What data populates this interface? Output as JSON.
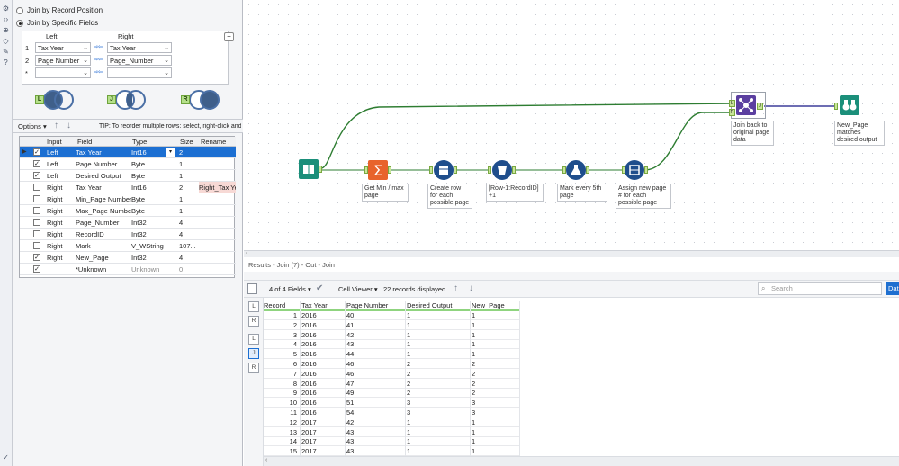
{
  "config": {
    "radio_record": "Join by Record Position",
    "radio_fields": "Join by Specific Fields",
    "hdr_left": "Left",
    "hdr_right": "Right",
    "join_rows": [
      {
        "num": "1",
        "left": "Tax Year",
        "right": "Tax Year"
      },
      {
        "num": "2",
        "left": "Page Number",
        "right": "Page_Number"
      },
      {
        "num": "*",
        "left": "",
        "right": ""
      }
    ],
    "venn_tags": [
      "L",
      "J",
      "R"
    ],
    "options_label": "Options",
    "tip": "TIP: To reorder multiple rows: select, right-click and dr",
    "select_headers": [
      "Input",
      "Field",
      "Type",
      "Size",
      "Rename"
    ],
    "select_rows": [
      {
        "checked": true,
        "input": "Left",
        "field": "Tax Year",
        "type": "Int16",
        "size": "2",
        "rename": ""
      },
      {
        "checked": true,
        "input": "Left",
        "field": "Page Number",
        "type": "Byte",
        "size": "1",
        "rename": ""
      },
      {
        "checked": true,
        "input": "Left",
        "field": "Desired Output",
        "type": "Byte",
        "size": "1",
        "rename": ""
      },
      {
        "checked": false,
        "input": "Right",
        "field": "Tax Year",
        "type": "Int16",
        "size": "2",
        "rename": "Right_Tax Yea"
      },
      {
        "checked": false,
        "input": "Right",
        "field": "Min_Page Number",
        "type": "Byte",
        "size": "1",
        "rename": ""
      },
      {
        "checked": false,
        "input": "Right",
        "field": "Max_Page Number",
        "type": "Byte",
        "size": "1",
        "rename": ""
      },
      {
        "checked": false,
        "input": "Right",
        "field": "Page_Number",
        "type": "Int32",
        "size": "4",
        "rename": ""
      },
      {
        "checked": false,
        "input": "Right",
        "field": "RecordID",
        "type": "Int32",
        "size": "4",
        "rename": ""
      },
      {
        "checked": false,
        "input": "Right",
        "field": "Mark",
        "type": "V_WString",
        "size": "107...",
        "rename": ""
      },
      {
        "checked": true,
        "input": "Right",
        "field": "New_Page",
        "type": "Int32",
        "size": "4",
        "rename": ""
      },
      {
        "checked": true,
        "input": "",
        "field": "*Unknown",
        "type": "Unknown",
        "size": "0",
        "rename": ""
      }
    ]
  },
  "canvas": {
    "labels": {
      "summarize": "Get Min / max page",
      "generate": "Create row for each possible page",
      "formula": "[Row-1:RecordID] +1",
      "filter": "Mark every 5th page",
      "multirow": "Assign new page # for each possible page",
      "join": "Join back to original page data",
      "browse": "New_Page matches desired output"
    },
    "join_anchors": [
      "L",
      "J",
      "R"
    ]
  },
  "results": {
    "title": "Results - Join (7) - Out - Join",
    "fields_label": "4 of 4 Fields",
    "viewer_label": "Cell Viewer",
    "records_label": "22 records displayed",
    "search_placeholder": "Search",
    "data_button": "Dat",
    "side_tabs": [
      "L",
      "R",
      "L",
      "J",
      "R"
    ],
    "headers": [
      "Record",
      "Tax Year",
      "Page Number",
      "Desired Output",
      "New_Page"
    ],
    "rows": [
      [
        "1",
        "2016",
        "40",
        "1",
        "1"
      ],
      [
        "2",
        "2016",
        "41",
        "1",
        "1"
      ],
      [
        "3",
        "2016",
        "42",
        "1",
        "1"
      ],
      [
        "4",
        "2016",
        "43",
        "1",
        "1"
      ],
      [
        "5",
        "2016",
        "44",
        "1",
        "1"
      ],
      [
        "6",
        "2016",
        "46",
        "2",
        "2"
      ],
      [
        "7",
        "2016",
        "46",
        "2",
        "2"
      ],
      [
        "8",
        "2016",
        "47",
        "2",
        "2"
      ],
      [
        "9",
        "2016",
        "49",
        "2",
        "2"
      ],
      [
        "10",
        "2016",
        "51",
        "3",
        "3"
      ],
      [
        "11",
        "2016",
        "54",
        "3",
        "3"
      ],
      [
        "12",
        "2017",
        "42",
        "1",
        "1"
      ],
      [
        "13",
        "2017",
        "43",
        "1",
        "1"
      ],
      [
        "14",
        "2017",
        "43",
        "1",
        "1"
      ],
      [
        "15",
        "2017",
        "43",
        "1",
        "1"
      ]
    ]
  },
  "colors": {
    "accent": "#1c6fd2",
    "join_purple": "#5b3fa0",
    "connector_green": "#2e7d32",
    "summarize_orange": "#e8632b",
    "tool_navy": "#1f4e8c",
    "browse_teal": "#1b8f7a"
  }
}
